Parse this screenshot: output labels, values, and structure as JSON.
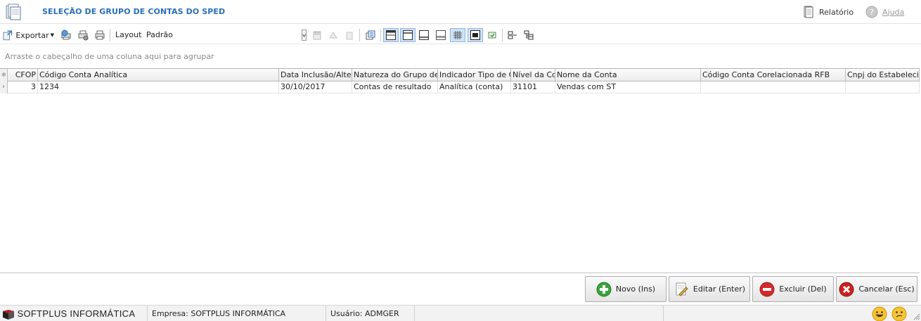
{
  "window": {
    "title": "SELEÇÃO DE GRUPO DE CONTAS DO SPED"
  },
  "titlebar": {
    "report_label": "Relatório",
    "help_label": "Ajuda"
  },
  "toolbar": {
    "export_label": "Exportar",
    "layout_label": "Layout",
    "layout_value": "Padrão"
  },
  "groupbar": {
    "hint": "Arraste o cabeçalho de uma coluna aqui para agrupar"
  },
  "grid": {
    "columns": [
      "CFOP",
      "Código Conta Analítica",
      "Data Inclusão/Alteração",
      "Natureza do Grupo de Contas",
      "Indicador Tipo de Conta",
      "Nível da Conta",
      "Nome da Conta",
      "Código Conta Corelacionada RFB",
      "Cnpj do Estabelecimento"
    ],
    "rows": [
      [
        "3",
        "1234",
        "30/10/2017",
        "Contas de resultado",
        "Analítica (conta)",
        "31101",
        "Vendas com ST",
        "",
        ""
      ]
    ]
  },
  "actions": {
    "new_label": "Novo (Ins)",
    "edit_label": "Editar (Enter)",
    "delete_label": "Excluir (Del)",
    "cancel_label": "Cancelar (Esc)"
  },
  "status": {
    "brand": "SOFTPLUS INFORMÁTICA",
    "company": "Empresa: SOFTPLUS INFORMÁTICA",
    "user": "Usuário: ADMGER"
  },
  "colors": {
    "title_blue": "#2a6fb7",
    "new_green": "#3aa23a",
    "delete_red": "#d22b2b",
    "cancel_red": "#cc2222"
  }
}
